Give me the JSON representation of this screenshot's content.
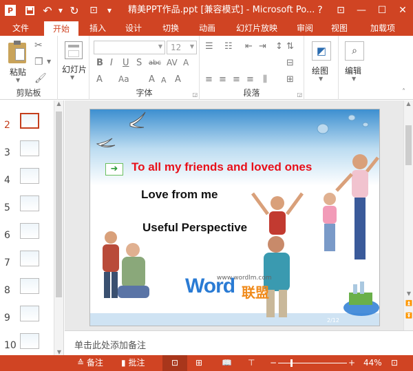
{
  "titlebar": {
    "title": "精美PPT作品.ppt [兼容模式] - Microsoft Po...",
    "help": "?",
    "accent": "#d04423"
  },
  "tabs": [
    "文件",
    "开始",
    "插入",
    "设计",
    "切换",
    "动画",
    "幻灯片放映",
    "审阅",
    "视图",
    "加载项"
  ],
  "ribbon": {
    "paste_label": "粘贴",
    "slides_label": "幻灯片",
    "font_size": "12",
    "drawing_label": "绘图",
    "edit_label": "编辑",
    "groups": [
      "剪贴板",
      "字体",
      "段落"
    ]
  },
  "thumbnails": [
    "2",
    "3",
    "4",
    "5",
    "6",
    "7",
    "8",
    "9",
    "10"
  ],
  "slide": {
    "line1": "To all my friends and loved ones",
    "line2": "Love from me",
    "line3": "Useful Perspective",
    "logo_url": "www.wordlm.com",
    "logo_word": "Word",
    "logo_cn": "联盟",
    "page": "2/12",
    "colors": {
      "red": "#e8101a",
      "blue": "#2a7bd4",
      "orange": "#f08a1a"
    }
  },
  "notes_placeholder": "单击此处添加备注",
  "statusbar": {
    "notes": "备注",
    "comments": "批注",
    "zoom": "44%"
  }
}
